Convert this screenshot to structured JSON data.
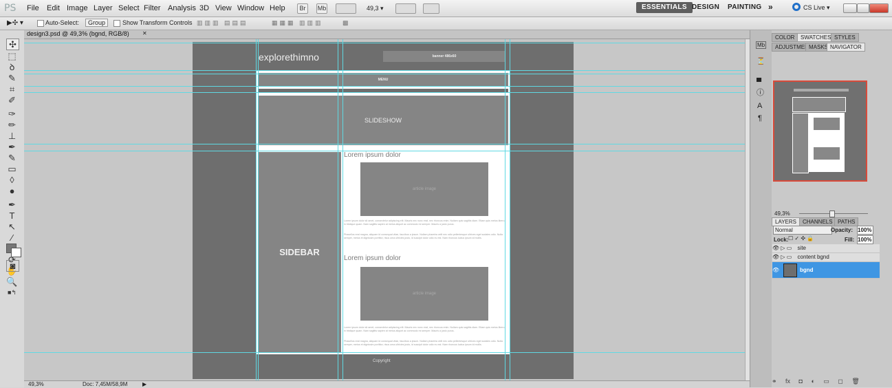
{
  "app": {
    "logo": "PS"
  },
  "menu": [
    "File",
    "Edit",
    "Image",
    "Layer",
    "Select",
    "Filter",
    "Analysis",
    "3D",
    "View",
    "Window",
    "Help"
  ],
  "menubar_buttons": {
    "br": "Br",
    "mb": "Mb",
    "zoom": "49,3 ▾"
  },
  "workspaces": {
    "essentials": "ESSENTIALS",
    "design": "DESIGN",
    "painting": "PAINTING",
    "more": "»",
    "cslive": "CS Live ▾"
  },
  "options_bar": {
    "auto_select_label": "Auto-Select:",
    "auto_select_value": "Group",
    "show_transform_label": "Show Transform Controls"
  },
  "document_tab": {
    "title": "design3.psd @ 49,3% (bgnd, RGB/8)",
    "close": "✕"
  },
  "design": {
    "logo_text": "explorethimno",
    "banner_text": "banner 486x60",
    "menu_text": "MENU",
    "slideshow_text": "SLIDESHOW",
    "sidebar_text": "SIDEBAR",
    "article1_title": "Lorem ipsum dolor",
    "article1_image": "article image",
    "article2_title": "Lorem ipsum dolor",
    "article2_image": "article image",
    "body_text": "Lorem ipsum dolor sit amet, consectetur adipiscing elit. Mauris nec nunc erat, nec rhoncus enim. Nullam quis sagittis diam. Etiam quis metus libero, in tristique quam. Nam sagittis sapien at metus aliquet ac commodo mi semper. Mauris a justo purus.",
    "body_text2": "Phasellus erat magna, aliquam id consequat vitae, faucibus a ipsum. Nullam pharetra velit nec odio pellentesque ultrices eget sodales odio. Nulla semper, metus et dignissim porttitor, risus urna ultricies justo, id suscipit dolor odio eu est. Nam rhoncus luctus ipsum id mollis.",
    "copyright": "Copyright"
  },
  "status": {
    "zoom": "49,3%",
    "doc": "Doc: 7,45M/58,9M"
  },
  "panels": {
    "top_tabs": [
      "COLOR",
      "SWATCHES",
      "STYLES"
    ],
    "second_tabs": [
      "ADJUSTMEN",
      "MASKS",
      "NAVIGATOR"
    ],
    "navigator_zoom": "49,3%",
    "layer_tabs": [
      "LAYERS",
      "CHANNELS",
      "PATHS"
    ],
    "blend_mode": "Normal",
    "opacity_label": "Opacity:",
    "opacity_value": "100%",
    "lock_label": "Lock:",
    "fill_label": "Fill:",
    "fill_value": "100%",
    "layers": [
      {
        "name": "site",
        "type": "group"
      },
      {
        "name": "content bgnd",
        "type": "group"
      },
      {
        "name": "bgnd",
        "type": "layer",
        "selected": true
      }
    ]
  }
}
